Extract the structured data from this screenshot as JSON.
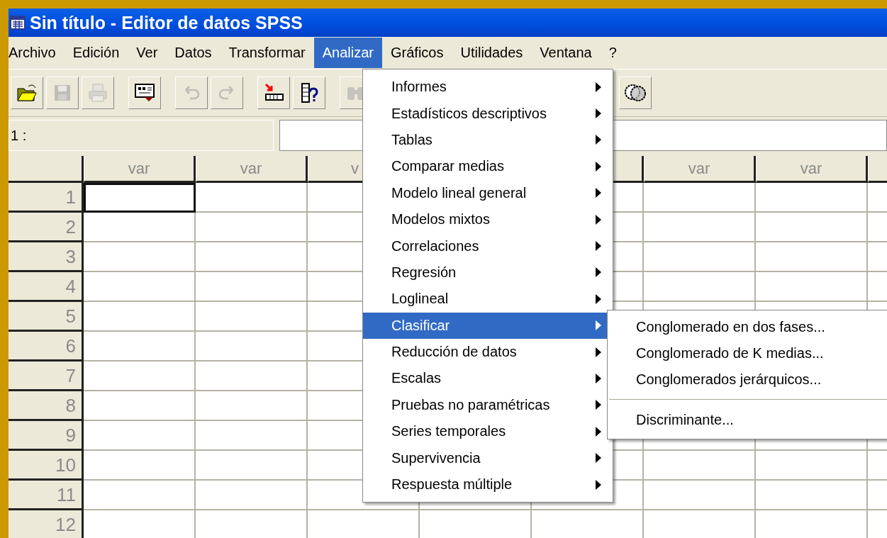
{
  "window": {
    "title": "Sin título - Editor de datos SPSS"
  },
  "menu_bar": [
    {
      "label": "Archivo",
      "selected": false
    },
    {
      "label": "Edición",
      "selected": false
    },
    {
      "label": "Ver",
      "selected": false
    },
    {
      "label": "Datos",
      "selected": false
    },
    {
      "label": "Transformar",
      "selected": false
    },
    {
      "label": "Analizar",
      "selected": true
    },
    {
      "label": "Gráficos",
      "selected": false
    },
    {
      "label": "Utilidades",
      "selected": false
    },
    {
      "label": "Ventana",
      "selected": false
    },
    {
      "label": "?",
      "selected": false
    }
  ],
  "toolbar": [
    {
      "kind": "open",
      "disabled": false
    },
    {
      "kind": "save",
      "disabled": true
    },
    {
      "kind": "print",
      "disabled": true
    },
    {
      "kind": "dialog",
      "disabled": false
    },
    {
      "kind": "undo",
      "disabled": true
    },
    {
      "kind": "redo",
      "disabled": true
    },
    {
      "kind": "goto",
      "disabled": false
    },
    {
      "kind": "variables",
      "disabled": false
    },
    {
      "kind": "find",
      "disabled": true
    },
    {
      "kind": "sets",
      "disabled": false
    }
  ],
  "cell_editor": {
    "reference": "1 :"
  },
  "grid": {
    "columns": [
      "var",
      "var",
      "v",
      null,
      null,
      "var",
      "var",
      null
    ],
    "rows": [
      {
        "label": "1",
        "active_cell": true
      },
      {
        "label": "2",
        "active_cell": false
      },
      {
        "label": "3",
        "active_cell": false
      },
      {
        "label": "4",
        "active_cell": false
      },
      {
        "label": "5",
        "active_cell": false
      },
      {
        "label": "6",
        "active_cell": false
      },
      {
        "label": "7",
        "active_cell": false
      },
      {
        "label": "8",
        "active_cell": false
      },
      {
        "label": "9",
        "active_cell": false
      },
      {
        "label": "10",
        "active_cell": false
      },
      {
        "label": "11",
        "active_cell": false
      },
      {
        "label": "12",
        "active_cell": false
      }
    ]
  },
  "analyze_menu": [
    {
      "label": "Informes",
      "selected": false
    },
    {
      "label": "Estadísticos descriptivos",
      "selected": false
    },
    {
      "label": "Tablas",
      "selected": false
    },
    {
      "label": "Comparar medias",
      "selected": false
    },
    {
      "label": "Modelo lineal general",
      "selected": false
    },
    {
      "label": "Modelos mixtos",
      "selected": false
    },
    {
      "label": "Correlaciones",
      "selected": false
    },
    {
      "label": "Regresión",
      "selected": false
    },
    {
      "label": "Loglineal",
      "selected": false
    },
    {
      "label": "Clasificar",
      "selected": true
    },
    {
      "label": "Reducción de datos",
      "selected": false
    },
    {
      "label": "Escalas",
      "selected": false
    },
    {
      "label": "Pruebas no paramétricas",
      "selected": false
    },
    {
      "label": "Series temporales",
      "selected": false
    },
    {
      "label": "Supervivencia",
      "selected": false
    },
    {
      "label": "Respuesta múltiple",
      "selected": false
    }
  ],
  "classify_submenu": [
    {
      "kind": "item",
      "label": "Conglomerado en dos fases..."
    },
    {
      "kind": "item",
      "label": "Conglomerado de K medias..."
    },
    {
      "kind": "item",
      "label": "Conglomerados jerárquicos..."
    },
    {
      "kind": "separator"
    },
    {
      "kind": "item",
      "label": "Discriminante..."
    }
  ]
}
